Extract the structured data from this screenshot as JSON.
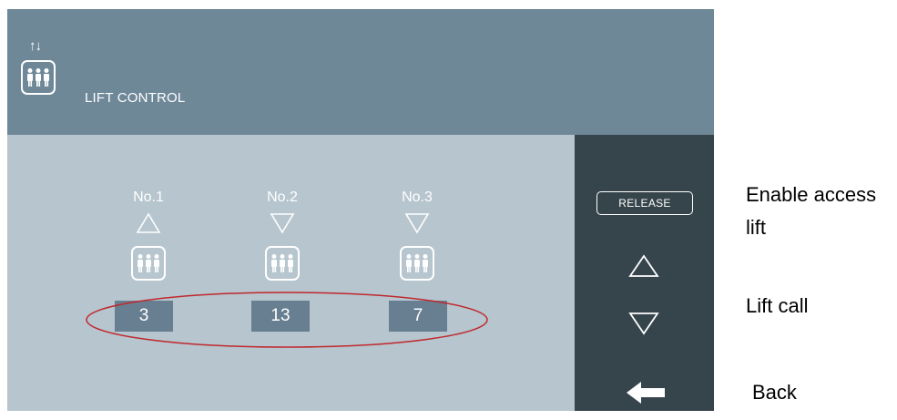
{
  "header": {
    "arrows": "↑↓",
    "title": "LIFT CONTROL",
    "icon": "lift-people-icon"
  },
  "lifts": [
    {
      "label": "No.1",
      "direction": "up",
      "floor": "3"
    },
    {
      "label": "No.2",
      "direction": "down",
      "floor": "13"
    },
    {
      "label": "No.3",
      "direction": "down",
      "floor": "7"
    }
  ],
  "side_panel": {
    "release_label": "RELEASE",
    "up_icon": "triangle-up-icon",
    "down_icon": "triangle-down-icon",
    "back_icon": "arrow-left-icon"
  },
  "notes": {
    "enable": "Enable access lift",
    "call": "Lift call",
    "back": "Back"
  },
  "colors": {
    "header_bg": "#6f8898",
    "screen_bg": "#b6c5ce",
    "side_panel_bg": "#36444c",
    "floor_box_bg": "#677f90",
    "highlight_ellipse": "#c0282d"
  }
}
